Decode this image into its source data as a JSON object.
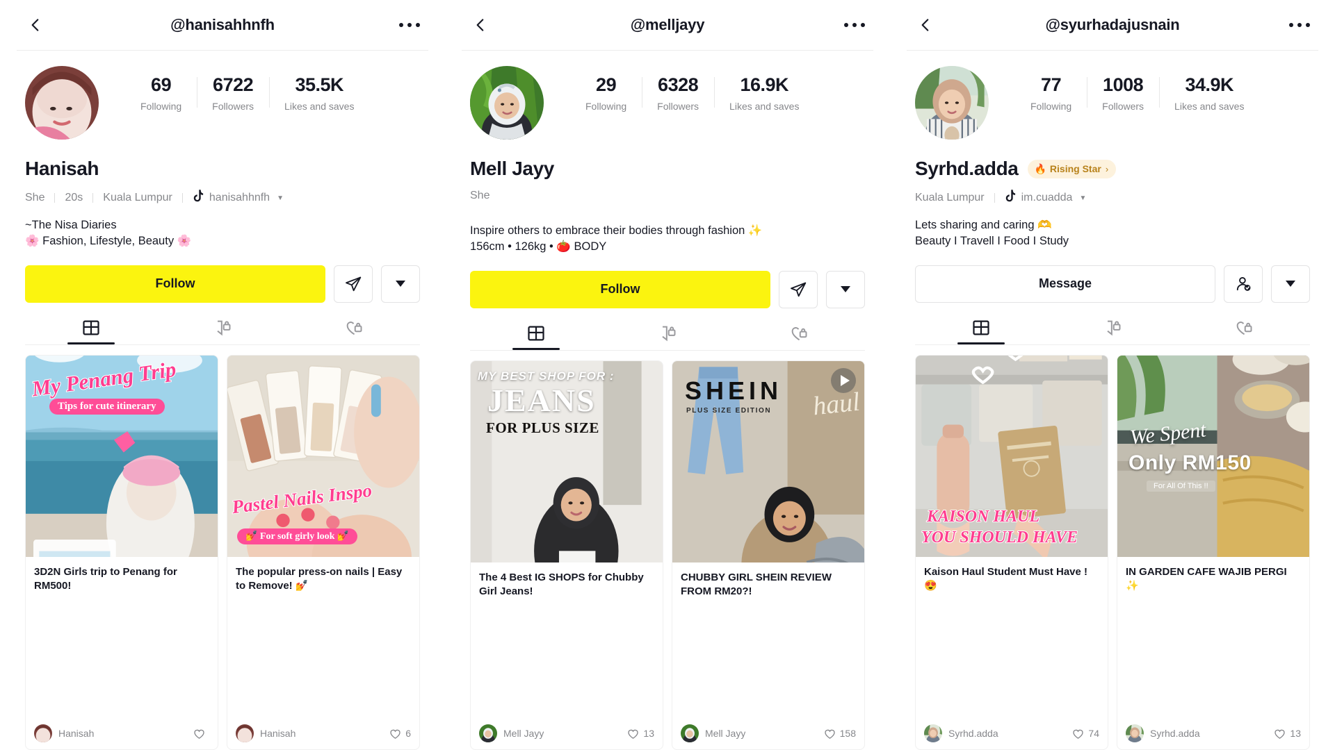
{
  "panels": [
    {
      "topbar": {
        "handle": "@hanisahhnfh",
        "back_icon": "chevron-left-icon",
        "more_icon": "ellipsis-icon"
      },
      "stats": [
        {
          "value": "69",
          "label": "Following"
        },
        {
          "value": "6722",
          "label": "Followers"
        },
        {
          "value": "35.5K",
          "label": "Likes and saves"
        }
      ],
      "display_name": "Hanisah",
      "badge": null,
      "meta": [
        "She",
        "20s",
        "Kuala Lumpur"
      ],
      "tiktok_handle": "hanisahhnfh",
      "bio": "~The Nisa Diaries\n🌸 Fashion, Lifestyle, Beauty 🌸",
      "primary_button": "Follow",
      "primary_button_kind": "follow",
      "secondary_icon": "send-message-icon",
      "tertiary_icon": "chevron-down-icon",
      "tabs": [
        {
          "icon": "grid-posts-icon",
          "active": true
        },
        {
          "icon": "bookmark-lock-icon",
          "active": false
        },
        {
          "icon": "heart-lock-icon",
          "active": false
        }
      ],
      "posts": [
        {
          "title": "3D2N Girls trip to Penang for RM500!",
          "author": "Hanisah",
          "likes": "",
          "is_video": false,
          "thumb": "penang-beach-trip",
          "overlay_main": "My Penang Trip",
          "overlay_sub": "Tips for cute itinerary"
        },
        {
          "title": "The popular press-on nails | Easy to Remove! 💅",
          "author": "Hanisah",
          "likes": "6",
          "is_video": false,
          "thumb": "pastel-nails",
          "overlay_main": "Pastel Nails Inspo",
          "overlay_sub": "💅 For soft girly look 💅"
        }
      ]
    },
    {
      "topbar": {
        "handle": "@melljayy",
        "back_icon": "chevron-left-icon",
        "more_icon": "ellipsis-icon"
      },
      "stats": [
        {
          "value": "29",
          "label": "Following"
        },
        {
          "value": "6328",
          "label": "Followers"
        },
        {
          "value": "16.9K",
          "label": "Likes and saves"
        }
      ],
      "display_name": "Mell Jayy",
      "badge": null,
      "meta": [
        "She"
      ],
      "tiktok_handle": null,
      "bio": "Inspire others to embrace their bodies through fashion ✨\n156cm • 126kg • 🍅 BODY",
      "primary_button": "Follow",
      "primary_button_kind": "follow",
      "secondary_icon": "send-message-icon",
      "tertiary_icon": "chevron-down-icon",
      "tabs": [
        {
          "icon": "grid-posts-icon",
          "active": true
        },
        {
          "icon": "bookmark-lock-icon",
          "active": false
        },
        {
          "icon": "heart-lock-icon",
          "active": false
        }
      ],
      "posts": [
        {
          "title": "The 4 Best IG SHOPS for Chubby Girl Jeans!",
          "author": "Mell Jayy",
          "likes": "13",
          "is_video": false,
          "thumb": "jeans-plus-size",
          "overlay_main": "JEANS",
          "overlay_top": "MY BEST SHOP FOR :",
          "overlay_sub": "FOR PLUS SIZE"
        },
        {
          "title": "CHUBBY GIRL SHEIN REVIEW FROM RM20?!",
          "author": "Mell Jayy",
          "likes": "158",
          "is_video": true,
          "thumb": "shein-haul",
          "overlay_main": "SHEIN",
          "overlay_sub": "PLUS SIZE EDITION",
          "overlay_script": "haul"
        }
      ]
    },
    {
      "topbar": {
        "handle": "@syurhadajusnain",
        "back_icon": "chevron-left-icon",
        "more_icon": "ellipsis-icon"
      },
      "stats": [
        {
          "value": "77",
          "label": "Following"
        },
        {
          "value": "1008",
          "label": "Followers"
        },
        {
          "value": "34.9K",
          "label": "Likes and saves"
        }
      ],
      "display_name": "Syrhd.adda",
      "badge": {
        "label": "Rising Star",
        "icon": "fire-icon",
        "chevron": "›",
        "bg": "#fdf2dd",
        "fg": "#b8821b"
      },
      "meta": [
        "Kuala Lumpur"
      ],
      "tiktok_handle": "im.cuadda",
      "bio": "Lets sharing and caring 🫶\nBeauty I Travell I Food I Study",
      "primary_button": "Message",
      "primary_button_kind": "message",
      "secondary_icon": "person-check-icon",
      "tertiary_icon": "chevron-down-icon",
      "tabs": [
        {
          "icon": "grid-posts-icon",
          "active": true
        },
        {
          "icon": "bookmark-lock-icon",
          "active": false
        },
        {
          "icon": "heart-lock-icon",
          "active": false
        }
      ],
      "posts": [
        {
          "title": "Kaison Haul Student Must Have ! 😍",
          "author": "Syrhd.adda",
          "likes": "74",
          "is_video": false,
          "thumb": "kaison-haul",
          "overlay_main": "KAISON HAUL",
          "overlay_sub": "YOU SHOULD HAVE"
        },
        {
          "title": "IN GARDEN CAFE WAJIB PERGI ✨",
          "author": "Syrhd.adda",
          "likes": "13",
          "is_video": false,
          "thumb": "garden-cafe",
          "overlay_script": "We Spent",
          "overlay_main": "Only RM150",
          "overlay_sub": "For All Of This !!"
        }
      ]
    }
  ],
  "colors": {
    "follow_yellow": "#fbf40f",
    "text_primary": "#161823",
    "text_muted": "#86878b",
    "border": "#e3e3e4",
    "badge_bg": "#fdf2dd",
    "badge_fg": "#b8821b"
  }
}
